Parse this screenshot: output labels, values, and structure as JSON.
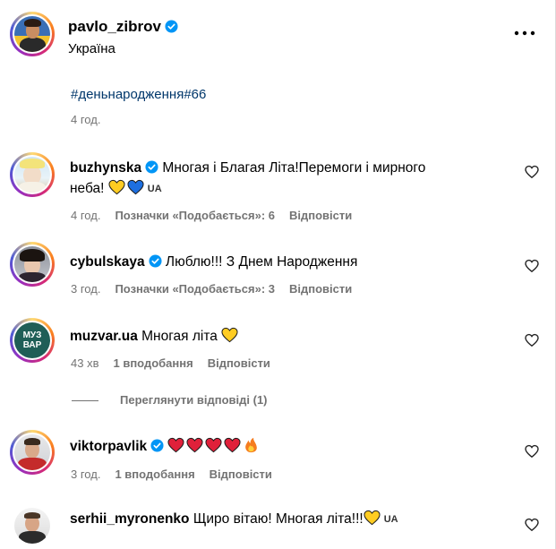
{
  "post": {
    "username": "pavlo_zibrov",
    "location": "Україна",
    "caption": "#деньнародження#66",
    "time": "4 год."
  },
  "comments": [
    {
      "username": "buzhynska",
      "text_line1": "Многая і Благая Літа!Перемоги і мирного",
      "text_line2": "неба!",
      "flag": "UA",
      "time": "4 год.",
      "likes": "Позначки «Подобається»: 6",
      "reply": "Відповісти",
      "verified": true
    },
    {
      "username": "cybulskaya",
      "text": "Люблю!!! З Днем Народження",
      "time": "3 год.",
      "likes": "Позначки «Подобається»: 3",
      "reply": "Відповісти",
      "verified": true
    },
    {
      "username": "muzvar.ua",
      "text": "Многая літа",
      "avatar_text_top": "МУЗ",
      "avatar_text_bottom": "ВАР",
      "time": "43 хв",
      "likes": "1 вподобання",
      "reply": "Відповісти",
      "verified": false
    },
    {
      "username": "viktorpavlik",
      "time": "3 год.",
      "likes": "1 вподобання",
      "reply": "Відповісти",
      "verified": true
    },
    {
      "username": "serhii_myronenko",
      "text": "Щиро вітаю! Многая літа!!!",
      "flag": "UA",
      "verified": false
    }
  ],
  "view_replies": "Переглянути відповіді (1)",
  "colors": {
    "verified_blue": "#0095f6",
    "meta_gray": "#737373",
    "link_blue": "#00376b",
    "heart_red": "#e0203a",
    "heart_yellow": "#ffcc22",
    "heart_blue": "#1d6fe0"
  },
  "icons": [
    "more-options-icon",
    "verified-badge-icon",
    "like-heart-icon",
    "yellow-heart-emoji",
    "blue-heart-emoji",
    "red-heart-emoji",
    "fire-emoji"
  ]
}
